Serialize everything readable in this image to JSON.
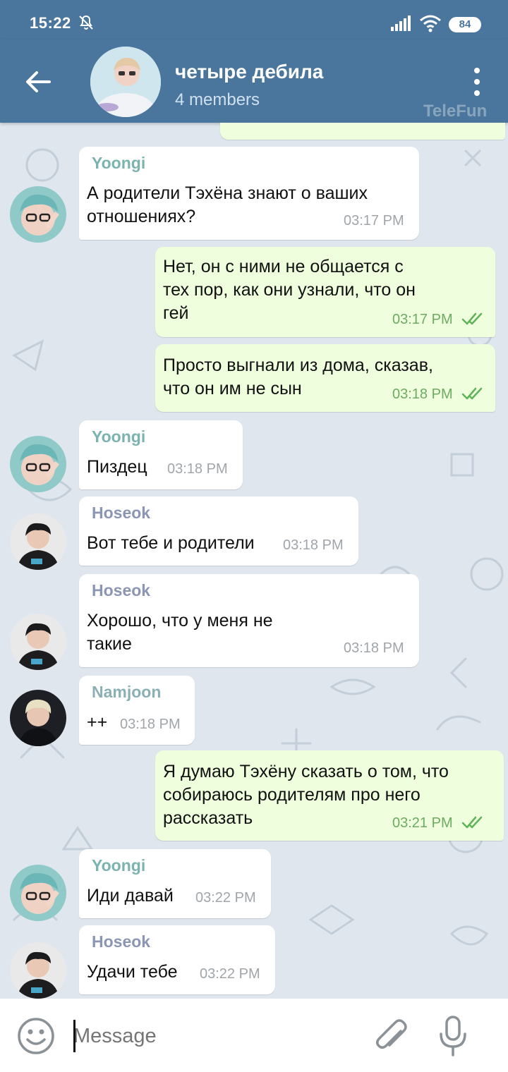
{
  "status_bar": {
    "time": "15:22",
    "battery": "84"
  },
  "header": {
    "title": "четыре дебила",
    "subtitle": "4 members",
    "watermark": "TeleFun"
  },
  "messages": [
    {
      "id": "m1",
      "sender": "Yoongi",
      "text": "А родители Тэхёна знают о ваших\nотношениях?",
      "time": "03:17 PM"
    },
    {
      "id": "m2",
      "text": "Нет, он с ними не общается с\nтех пор, как они узнали, что он\nгей",
      "time": "03:17 PM"
    },
    {
      "id": "m3",
      "text": "Просто выгнали из дома, сказав,\nчто он им не сын",
      "time": "03:18 PM"
    },
    {
      "id": "m4",
      "sender": "Yoongi",
      "text": "Пиздец",
      "time": "03:18 PM"
    },
    {
      "id": "m5",
      "sender": "Hoseok",
      "text": "Вот тебе и родители",
      "time": "03:18 PM"
    },
    {
      "id": "m6",
      "sender": "Hoseok",
      "text": "Хорошо, что у меня не\nтакие",
      "time": "03:18 PM"
    },
    {
      "id": "m7",
      "sender": "Namjoon",
      "text": "++",
      "time": "03:18 PM"
    },
    {
      "id": "m8",
      "text": "Я думаю Тэхёну сказать о том, что\nсобираюсь родителям про него\nрассказать",
      "time": "03:21 PM"
    },
    {
      "id": "m9",
      "sender": "Yoongi",
      "text": "Иди давай",
      "time": "03:22 PM"
    },
    {
      "id": "m10",
      "sender": "Hoseok",
      "text": "Удачи тебе",
      "time": "03:22 PM"
    }
  ],
  "sender_colors": {
    "Yoongi": "#7ab3b0",
    "Hoseok": "#8c96b4",
    "Namjoon": "#8ab0b5"
  },
  "input": {
    "placeholder": "Message"
  },
  "icons": [
    "back-arrow-icon",
    "more-vertical-icon",
    "emoji-icon",
    "attach-icon",
    "mic-icon",
    "double-check-icon",
    "mute-icon",
    "signal-icon",
    "wifi-icon"
  ]
}
